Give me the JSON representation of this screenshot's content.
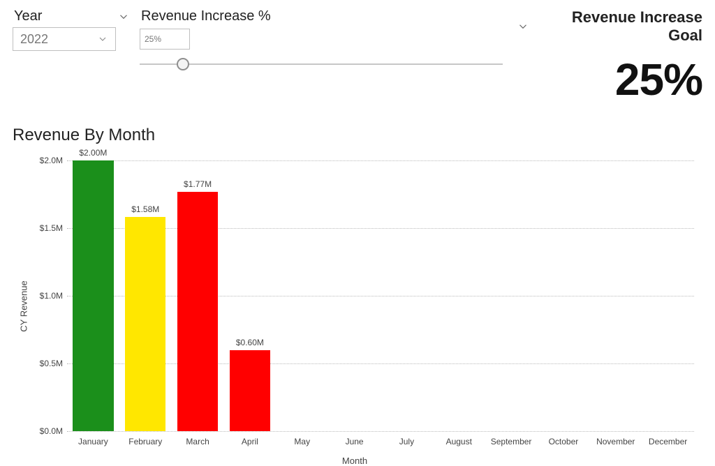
{
  "year_slicer": {
    "title": "Year",
    "selected": "2022"
  },
  "param": {
    "title": "Revenue Increase %",
    "value_text": "25%",
    "slider_pct": 12
  },
  "goal": {
    "title": "Revenue Increase Goal",
    "value": "25%"
  },
  "chart_title": "Revenue By Month",
  "chart_data": {
    "type": "bar",
    "title": "Revenue By Month",
    "xlabel": "Month",
    "ylabel": "CY Revenue",
    "ylim": [
      0,
      2.0
    ],
    "y_ticks": [
      {
        "v": 0.0,
        "label": "$0.0M"
      },
      {
        "v": 0.5,
        "label": "$0.5M"
      },
      {
        "v": 1.0,
        "label": "$1.0M"
      },
      {
        "v": 1.5,
        "label": "$1.5M"
      },
      {
        "v": 2.0,
        "label": "$2.0M"
      }
    ],
    "categories": [
      "January",
      "February",
      "March",
      "April",
      "May",
      "June",
      "July",
      "August",
      "September",
      "October",
      "November",
      "December"
    ],
    "values": [
      2.0,
      1.58,
      1.77,
      0.6,
      null,
      null,
      null,
      null,
      null,
      null,
      null,
      null
    ],
    "bar_labels": [
      "$2.00M",
      "$1.58M",
      "$1.77M",
      "$0.60M",
      "",
      "",
      "",
      "",
      "",
      "",
      "",
      ""
    ],
    "bar_colors": [
      "#1b8f1b",
      "#ffe700",
      "#ff0000",
      "#ff0000",
      "",
      "",
      "",
      "",
      "",
      "",
      "",
      ""
    ],
    "bar_width_frac": 0.78
  }
}
